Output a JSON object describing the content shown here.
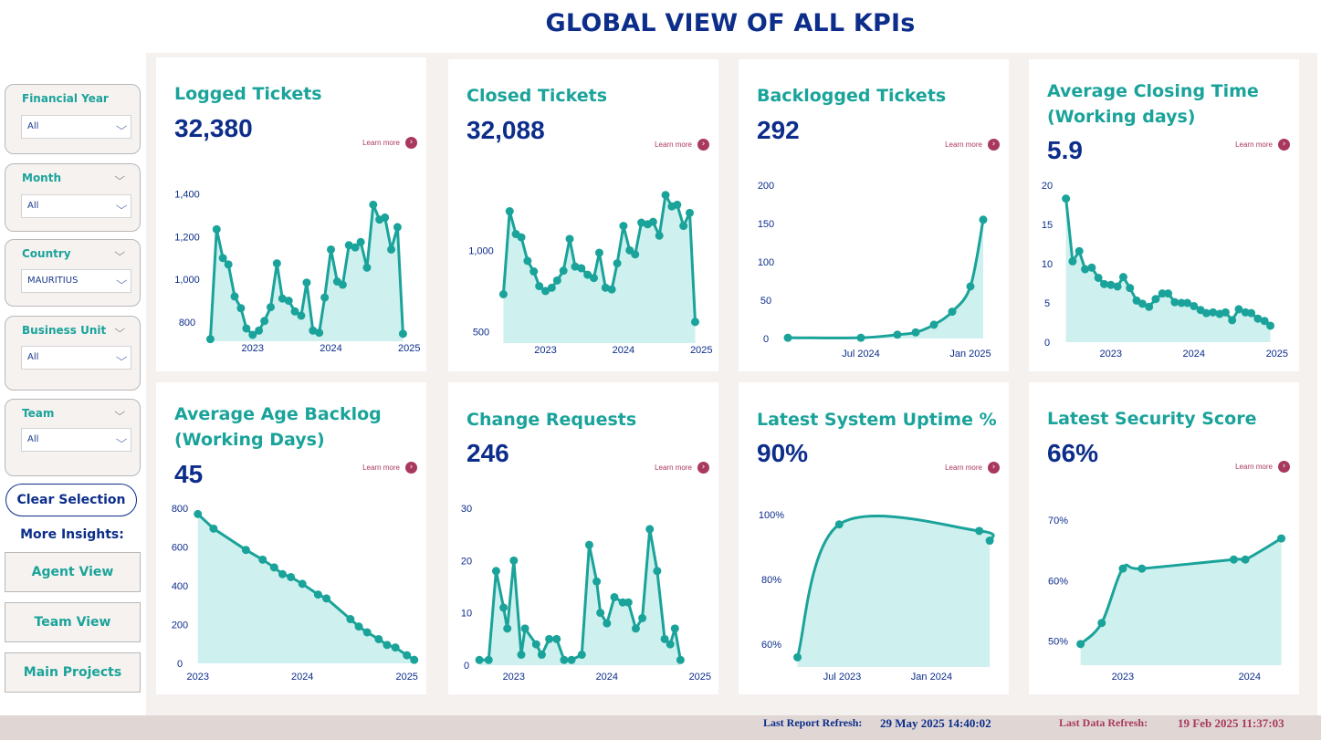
{
  "title": "GLOBAL VIEW OF ALL KPIs",
  "filters": [
    {
      "label": "Financial Year",
      "value": "All",
      "header_chevron": false
    },
    {
      "label": "Month",
      "value": "All",
      "header_chevron": true
    },
    {
      "label": "Country",
      "value": "MAURITIUS",
      "header_chevron": true
    },
    {
      "label": "Business Unit",
      "value": "All",
      "header_chevron": true
    },
    {
      "label": "Team",
      "value": "All",
      "header_chevron": true
    }
  ],
  "clear_selection": "Clear Selection",
  "more_insights": "More Insights:",
  "nav": [
    "Agent View",
    "Team View",
    "Main Projects"
  ],
  "learn_more": "Learn more",
  "colors": {
    "title": "#0c2d8a",
    "accent": "#1aa39a",
    "area": "#cef0ee",
    "learn": "#a8385e"
  },
  "cards": [
    {
      "title": "Logged Tickets",
      "value": "32,380"
    },
    {
      "title": "Closed Tickets",
      "value": "32,088"
    },
    {
      "title": "Backlogged Tickets",
      "value": "292"
    },
    {
      "title": "Average Closing Time (Working days)",
      "value": "5.9"
    },
    {
      "title": "Average Age Backlog (Working Days)",
      "value": "45"
    },
    {
      "title": "Change Requests",
      "value": "246"
    },
    {
      "title": "Latest System Uptime %",
      "value": "90%"
    },
    {
      "title": "Latest Security Score",
      "value": "66%"
    }
  ],
  "chart_data": [
    {
      "type": "area",
      "name": "Logged Tickets",
      "x_ticks": [
        {
          "label": "2023",
          "x": 2023
        },
        {
          "label": "2024",
          "x": 2024
        },
        {
          "label": "2025",
          "x": 2025
        }
      ],
      "y_ticks": [
        {
          "label": "1,400",
          "v": 1400
        },
        {
          "label": "1,200",
          "v": 1200
        },
        {
          "label": "1,000",
          "v": 1000
        },
        {
          "label": "800",
          "v": 800
        }
      ],
      "xlim": [
        2022.42,
        2025.09
      ],
      "ylim": [
        710,
        1450
      ],
      "x": [
        2022.46,
        2022.54,
        2022.62,
        2022.69,
        2022.77,
        2022.85,
        2022.92,
        2023.0,
        2023.08,
        2023.15,
        2023.23,
        2023.31,
        2023.38,
        2023.46,
        2023.54,
        2023.62,
        2023.69,
        2023.77,
        2023.85,
        2023.92,
        2024.0,
        2024.08,
        2024.15,
        2024.23,
        2024.31,
        2024.38,
        2024.46,
        2024.54,
        2024.62,
        2024.69,
        2024.77,
        2024.85,
        2024.92,
        2025.0,
        2025.08
      ],
      "y": [
        720,
        1235,
        1100,
        1070,
        920,
        865,
        770,
        740,
        760,
        805,
        870,
        1075,
        910,
        900,
        850,
        830,
        985,
        760,
        750,
        915,
        1140,
        990,
        975,
        1160,
        1150,
        1175,
        1055,
        1350,
        1280,
        1290,
        1140,
        1245,
        745
      ],
      "line_smooth": false
    },
    {
      "type": "area",
      "name": "Closed Tickets",
      "x_ticks": [
        {
          "label": "2023",
          "x": 2023
        },
        {
          "label": "2024",
          "x": 2024
        },
        {
          "label": "2025",
          "x": 2025
        }
      ],
      "y_ticks": [
        {
          "label": "1,000",
          "v": 1000
        },
        {
          "label": "500",
          "v": 500
        }
      ],
      "xlim": [
        2022.42,
        2025.09
      ],
      "ylim": [
        430,
        1400
      ],
      "x": [
        2022.46,
        2022.54,
        2022.62,
        2022.69,
        2022.77,
        2022.85,
        2022.92,
        2023.0,
        2023.08,
        2023.15,
        2023.23,
        2023.31,
        2023.38,
        2023.46,
        2023.54,
        2023.62,
        2023.69,
        2023.77,
        2023.85,
        2023.92,
        2024.0,
        2024.08,
        2024.15,
        2024.23,
        2024.31,
        2024.38,
        2024.46,
        2024.54,
        2024.62,
        2024.69,
        2024.77,
        2024.85,
        2024.92,
        2025.0,
        2025.08
      ],
      "y": [
        730,
        1240,
        1100,
        1080,
        935,
        870,
        780,
        750,
        770,
        815,
        875,
        1070,
        900,
        890,
        850,
        830,
        985,
        770,
        760,
        920,
        1150,
        1000,
        975,
        1170,
        1160,
        1175,
        1090,
        1340,
        1270,
        1280,
        1150,
        1230,
        560
      ],
      "line_smooth": false
    },
    {
      "type": "area",
      "name": "Backlogged Tickets",
      "x_ticks": [
        {
          "label": "Jul 2024",
          "x": 4.0
        },
        {
          "label": "Jan 2025",
          "x": 10.0
        }
      ],
      "y_ticks": [
        {
          "label": "200",
          "v": 200
        },
        {
          "label": "150",
          "v": 150
        },
        {
          "label": "100",
          "v": 100
        },
        {
          "label": "50",
          "v": 50
        },
        {
          "label": "0",
          "v": 0
        }
      ],
      "xlim": [
        -0.3,
        10.8
      ],
      "ylim": [
        0,
        200
      ],
      "x": [
        0,
        4.0,
        6.0,
        7.0,
        8.0,
        9.0,
        10.0,
        10.7
      ],
      "y": [
        1,
        1,
        5,
        8,
        18,
        35,
        68,
        155
      ],
      "line_smooth": true
    },
    {
      "type": "area",
      "name": "Average Closing Time (Working days)",
      "x_ticks": [
        {
          "label": "2023",
          "x": 2023
        },
        {
          "label": "2024",
          "x": 2024
        },
        {
          "label": "2025",
          "x": 2025
        }
      ],
      "y_ticks": [
        {
          "label": "20",
          "v": 20
        },
        {
          "label": "15",
          "v": 15
        },
        {
          "label": "10",
          "v": 10
        },
        {
          "label": "5",
          "v": 5
        },
        {
          "label": "0",
          "v": 0
        }
      ],
      "xlim": [
        2022.42,
        2025.09
      ],
      "ylim": [
        0,
        20
      ],
      "x": [
        2022.46,
        2022.54,
        2022.62,
        2022.69,
        2022.77,
        2022.85,
        2022.92,
        2023.0,
        2023.08,
        2023.15,
        2023.23,
        2023.31,
        2023.38,
        2023.46,
        2023.54,
        2023.62,
        2023.69,
        2023.77,
        2023.85,
        2023.92,
        2024.0,
        2024.08,
        2024.15,
        2024.23,
        2024.31,
        2024.38,
        2024.46,
        2024.54,
        2024.62,
        2024.69,
        2024.77,
        2024.85,
        2024.92,
        2025.0,
        2025.08
      ],
      "y": [
        18.3,
        10.3,
        11.6,
        9.3,
        9.5,
        8.2,
        7.4,
        7.3,
        7.1,
        8.3,
        6.9,
        5.3,
        4.9,
        4.5,
        5.5,
        6.2,
        6.2,
        5.1,
        5.0,
        5.0,
        4.6,
        4.1,
        3.7,
        3.8,
        3.6,
        3.8,
        2.8,
        4.2,
        3.8,
        3.7,
        3.0,
        2.7,
        2.1
      ],
      "line_smooth": false
    },
    {
      "type": "area",
      "name": "Average Age Backlog (Working Days)",
      "x_ticks": [
        {
          "label": "2023",
          "x": 2023
        },
        {
          "label": "2024",
          "x": 2024
        },
        {
          "label": "2025",
          "x": 2025
        }
      ],
      "y_ticks": [
        {
          "label": "800",
          "v": 800
        },
        {
          "label": "600",
          "v": 600
        },
        {
          "label": "400",
          "v": 400
        },
        {
          "label": "200",
          "v": 200
        },
        {
          "label": "0",
          "v": 0
        }
      ],
      "xlim": [
        2022.95,
        2025.09
      ],
      "ylim": [
        0,
        800
      ],
      "x": [
        2023.0,
        2023.15,
        2023.46,
        2023.62,
        2023.73,
        2023.81,
        2023.89,
        2024.0,
        2024.15,
        2024.23,
        2024.46,
        2024.54,
        2024.62,
        2024.73,
        2024.81,
        2024.89,
        2025.0,
        2025.07
      ],
      "y": [
        770,
        695,
        585,
        535,
        495,
        460,
        445,
        410,
        355,
        335,
        228,
        190,
        160,
        125,
        95,
        82,
        42,
        18
      ],
      "line_smooth": false
    },
    {
      "type": "area",
      "name": "Change Requests",
      "x_ticks": [
        {
          "label": "2023",
          "x": 2023
        },
        {
          "label": "2024",
          "x": 2024
        },
        {
          "label": "2025",
          "x": 2025
        }
      ],
      "y_ticks": [
        {
          "label": "30",
          "v": 30
        },
        {
          "label": "20",
          "v": 20
        },
        {
          "label": "10",
          "v": 10
        },
        {
          "label": "0",
          "v": 0
        }
      ],
      "xlim": [
        2022.59,
        2025.09
      ],
      "ylim": [
        0,
        30
      ],
      "x": [
        2022.63,
        2022.73,
        2022.81,
        2022.89,
        2022.93,
        2023.0,
        2023.08,
        2023.12,
        2023.24,
        2023.3,
        2023.38,
        2023.46,
        2023.54,
        2023.62,
        2023.73,
        2023.81,
        2023.89,
        2023.93,
        2024.0,
        2024.08,
        2024.17,
        2024.23,
        2024.31,
        2024.38,
        2024.46,
        2024.54,
        2024.62,
        2024.68,
        2024.73,
        2024.79,
        2024.87,
        2024.92,
        2025.0,
        2025.07
      ],
      "y": [
        1,
        1,
        18,
        11,
        7,
        20,
        2,
        7,
        4,
        2,
        5,
        5,
        1,
        1,
        2,
        23,
        16,
        10,
        8,
        13,
        12,
        12,
        7,
        9,
        26,
        18,
        5,
        4,
        7,
        1
      ],
      "line_smooth": false
    },
    {
      "type": "area",
      "name": "Latest System Uptime %",
      "x_ticks": [
        {
          "label": "Jul 2023",
          "x": 3.0
        },
        {
          "label": "Jan 2024",
          "x": 9.0
        }
      ],
      "y_ticks": [
        {
          "label": "100%",
          "v": 100
        },
        {
          "label": "80%",
          "v": 80
        },
        {
          "label": "60%",
          "v": 60
        }
      ],
      "xlim": [
        -0.4,
        13.2
      ],
      "ylim": [
        53,
        102
      ],
      "x": [
        0,
        2.8,
        12.2,
        12.9
      ],
      "y": [
        56,
        97,
        95,
        92
      ],
      "line_smooth": true
    },
    {
      "type": "area",
      "name": "Latest Security Score",
      "x_ticks": [
        {
          "label": "2023",
          "x": 0.0
        },
        {
          "label": "2024",
          "x": 12.0
        }
      ],
      "y_ticks": [
        {
          "label": "70%",
          "v": 70
        },
        {
          "label": "60%",
          "v": 60
        },
        {
          "label": "50%",
          "v": 50
        }
      ],
      "xlim": [
        -4.4,
        15.3
      ],
      "ylim": [
        46,
        72
      ],
      "x": [
        -4.0,
        -2.0,
        0,
        1.8,
        10.5,
        11.6,
        15.0
      ],
      "y": [
        49.5,
        53,
        62,
        62,
        63.5,
        63.5,
        67
      ],
      "line_smooth": true
    }
  ]
}
